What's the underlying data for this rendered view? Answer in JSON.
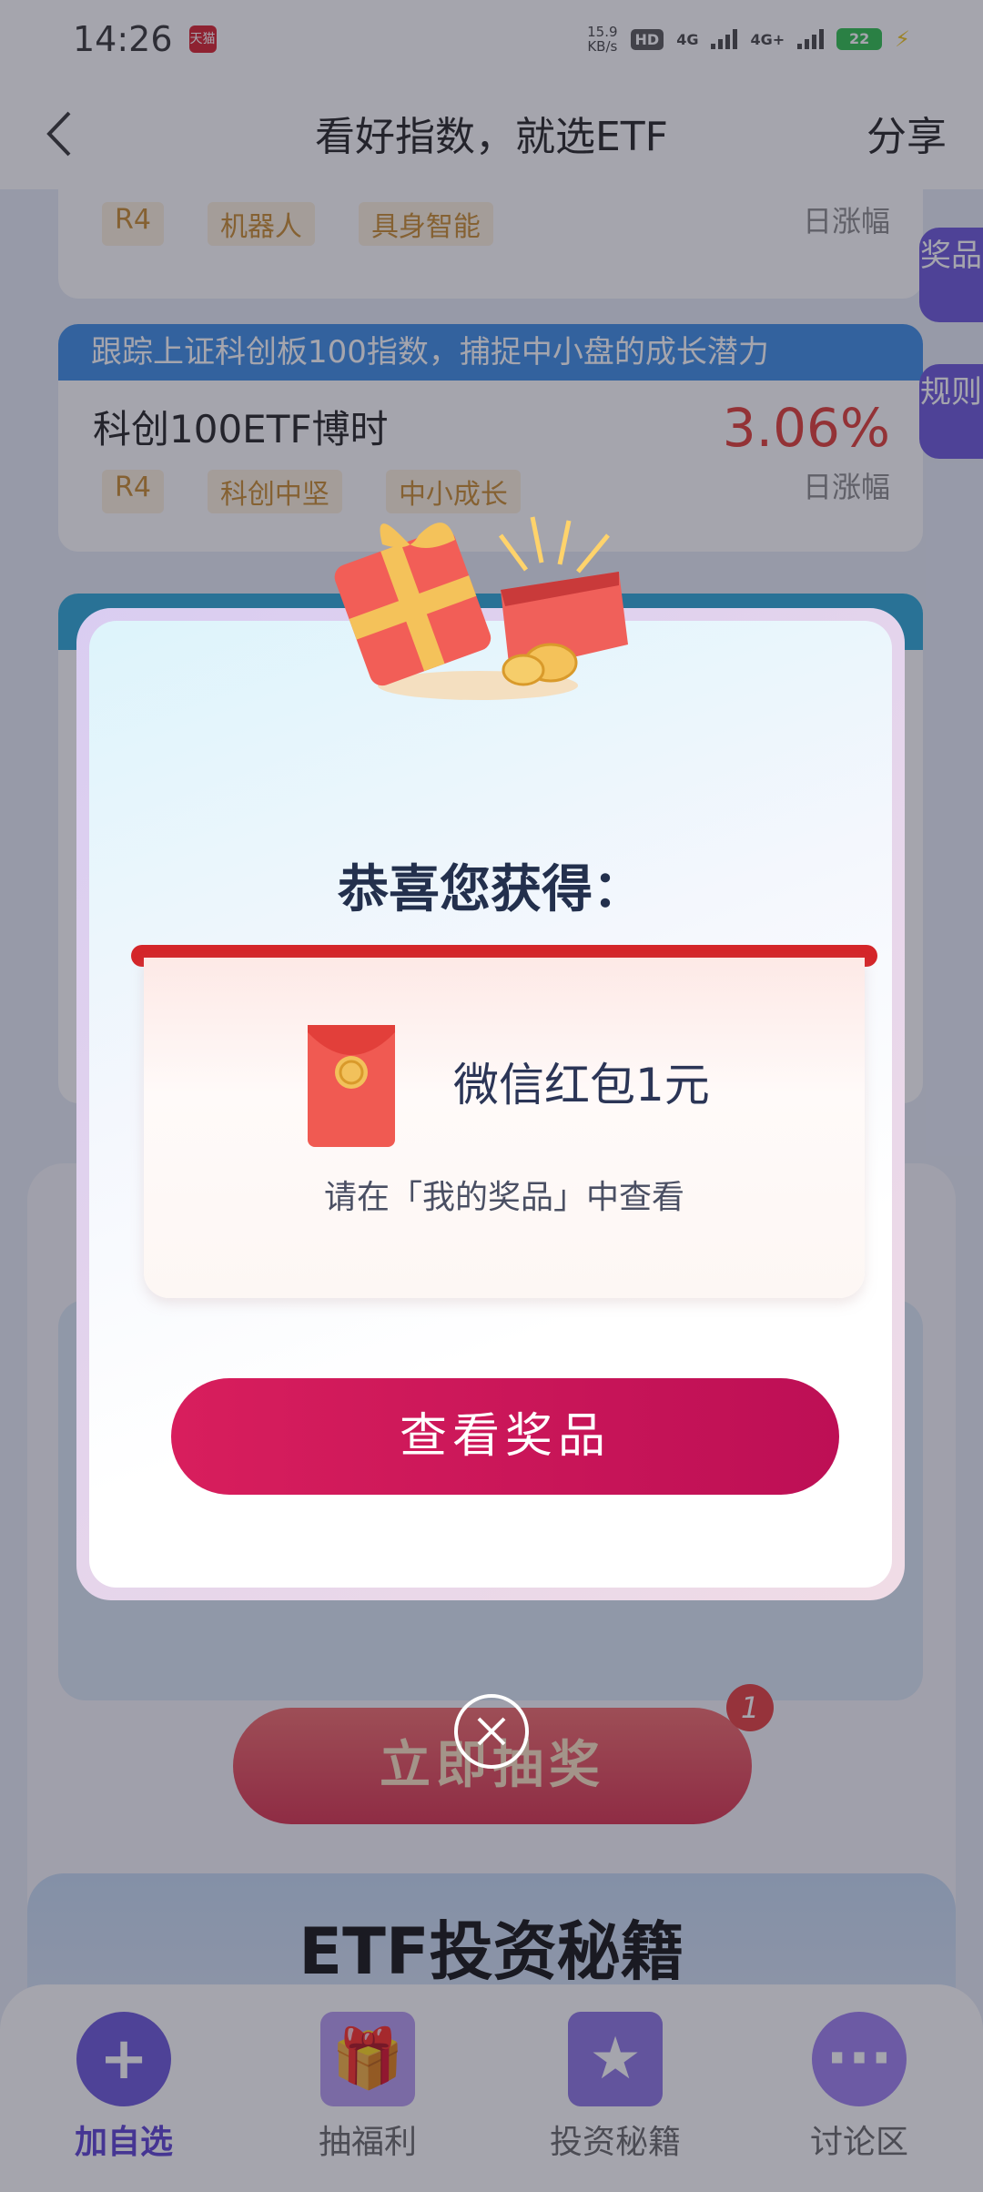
{
  "status_bar": {
    "time": "14:26",
    "app_icon_label": "天猫",
    "net_speed": "15.9",
    "net_unit": "KB/s",
    "hd": "HD",
    "sim1": "4G",
    "sim2": "4G+",
    "battery": "22"
  },
  "nav": {
    "title": "看好指数，就选ETF",
    "share": "分享"
  },
  "fund_cards": [
    {
      "tags": [
        "R4",
        "机器人",
        "具身智能"
      ],
      "rise_label": "日涨幅"
    },
    {
      "banner": "跟踪上证科创板100指数，捕捉中小盘的成长潜力",
      "name": "科创100ETF博时",
      "rise": "3.06%",
      "rise_label": "日涨幅",
      "tags": [
        "R4",
        "科创中坚",
        "中小成长"
      ]
    }
  ],
  "side_tabs": {
    "prizes": "奖品",
    "rules": "规则"
  },
  "lottery": {
    "draw_label": "立即抽奖",
    "badge": "1"
  },
  "tips": {
    "title": "ETF投资秘籍"
  },
  "tab_bar": [
    {
      "label": "加自选"
    },
    {
      "label": "抽福利"
    },
    {
      "label": "投资秘籍"
    },
    {
      "label": "讨论区"
    }
  ],
  "dialog": {
    "title": "恭喜您获得：",
    "prize_name": "微信红包1元",
    "hint": "请在「我的奖品」中查看",
    "button": "查看奖品"
  },
  "colors": {
    "accent": "#c8145a",
    "rise": "#e03a33",
    "purple": "#6a55d9"
  }
}
